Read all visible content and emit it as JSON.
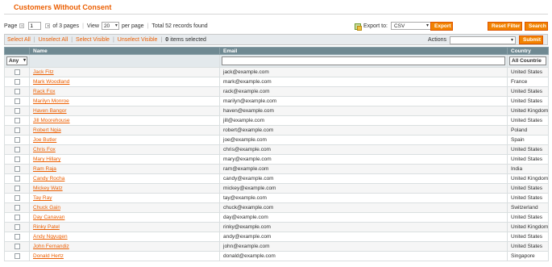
{
  "page_title": "Customers Without Consent",
  "pager": {
    "page_label": "Page",
    "page_value": "1",
    "of_pages": "of 3 pages",
    "view_label": "View",
    "per_page_value": "20",
    "per_page_label": "per page",
    "total": "Total 52 records found"
  },
  "export": {
    "label": "Export to:",
    "format": "CSV",
    "button": "Export"
  },
  "buttons": {
    "reset_filter": "Reset Filter",
    "search": "Search",
    "submit": "Submit"
  },
  "massaction": {
    "select_all": "Select All",
    "unselect_all": "Unselect All",
    "select_visible": "Select Visible",
    "unselect_visible": "Unselect Visible",
    "selected_count": "0",
    "selected_label": "items selected",
    "actions_label": "Actions",
    "actions_value": ""
  },
  "grid": {
    "columns": [
      "Name",
      "Email",
      "Country"
    ],
    "filter": {
      "checkbox_filter": "Any",
      "email_filter": "",
      "country_filter": "All Countrie"
    },
    "rows": [
      {
        "name": "Jack Fitz",
        "email": "jack@example.com",
        "country": "United States"
      },
      {
        "name": "Mark Woodland",
        "email": "mark@example.com",
        "country": "France"
      },
      {
        "name": "Rack Fox",
        "email": "rack@example.com",
        "country": "United States"
      },
      {
        "name": "Marilyn Monroe",
        "email": "marilyn@example.com",
        "country": "United States"
      },
      {
        "name": "Haven Bangor",
        "email": "haven@example.com",
        "country": "United Kingdom"
      },
      {
        "name": "Jill Moorehouse",
        "email": "jill@example.com",
        "country": "United States"
      },
      {
        "name": "Robert Ngia",
        "email": "robert@example.com",
        "country": "Poland"
      },
      {
        "name": "Joe Butler",
        "email": "joe@example.com",
        "country": "Spain"
      },
      {
        "name": "Chris Fox",
        "email": "chris@example.com",
        "country": "United States"
      },
      {
        "name": "Mary Hillary",
        "email": "mary@example.com",
        "country": "United States"
      },
      {
        "name": "Ram Raja",
        "email": "ram@example.com",
        "country": "India"
      },
      {
        "name": "Candy Rocha",
        "email": "candy@example.com",
        "country": "United Kingdom"
      },
      {
        "name": "Mickey Watz",
        "email": "mickey@example.com",
        "country": "United States"
      },
      {
        "name": "Tay Ray",
        "email": "tay@example.com",
        "country": "United States"
      },
      {
        "name": "Chuck Gain",
        "email": "chuck@example.com",
        "country": "Switzerland"
      },
      {
        "name": "Day Canavan",
        "email": "day@example.com",
        "country": "United States"
      },
      {
        "name": "Rinky Patel",
        "email": "rinky@example.com",
        "country": "United Kingdom"
      },
      {
        "name": "Andy Ngyugen",
        "email": "andy@example.com",
        "country": "United States"
      },
      {
        "name": "John Fernandiz",
        "email": "john@example.com",
        "country": "United States"
      },
      {
        "name": "Donald Hertz",
        "email": "donald@example.com",
        "country": "Singapore"
      }
    ]
  }
}
